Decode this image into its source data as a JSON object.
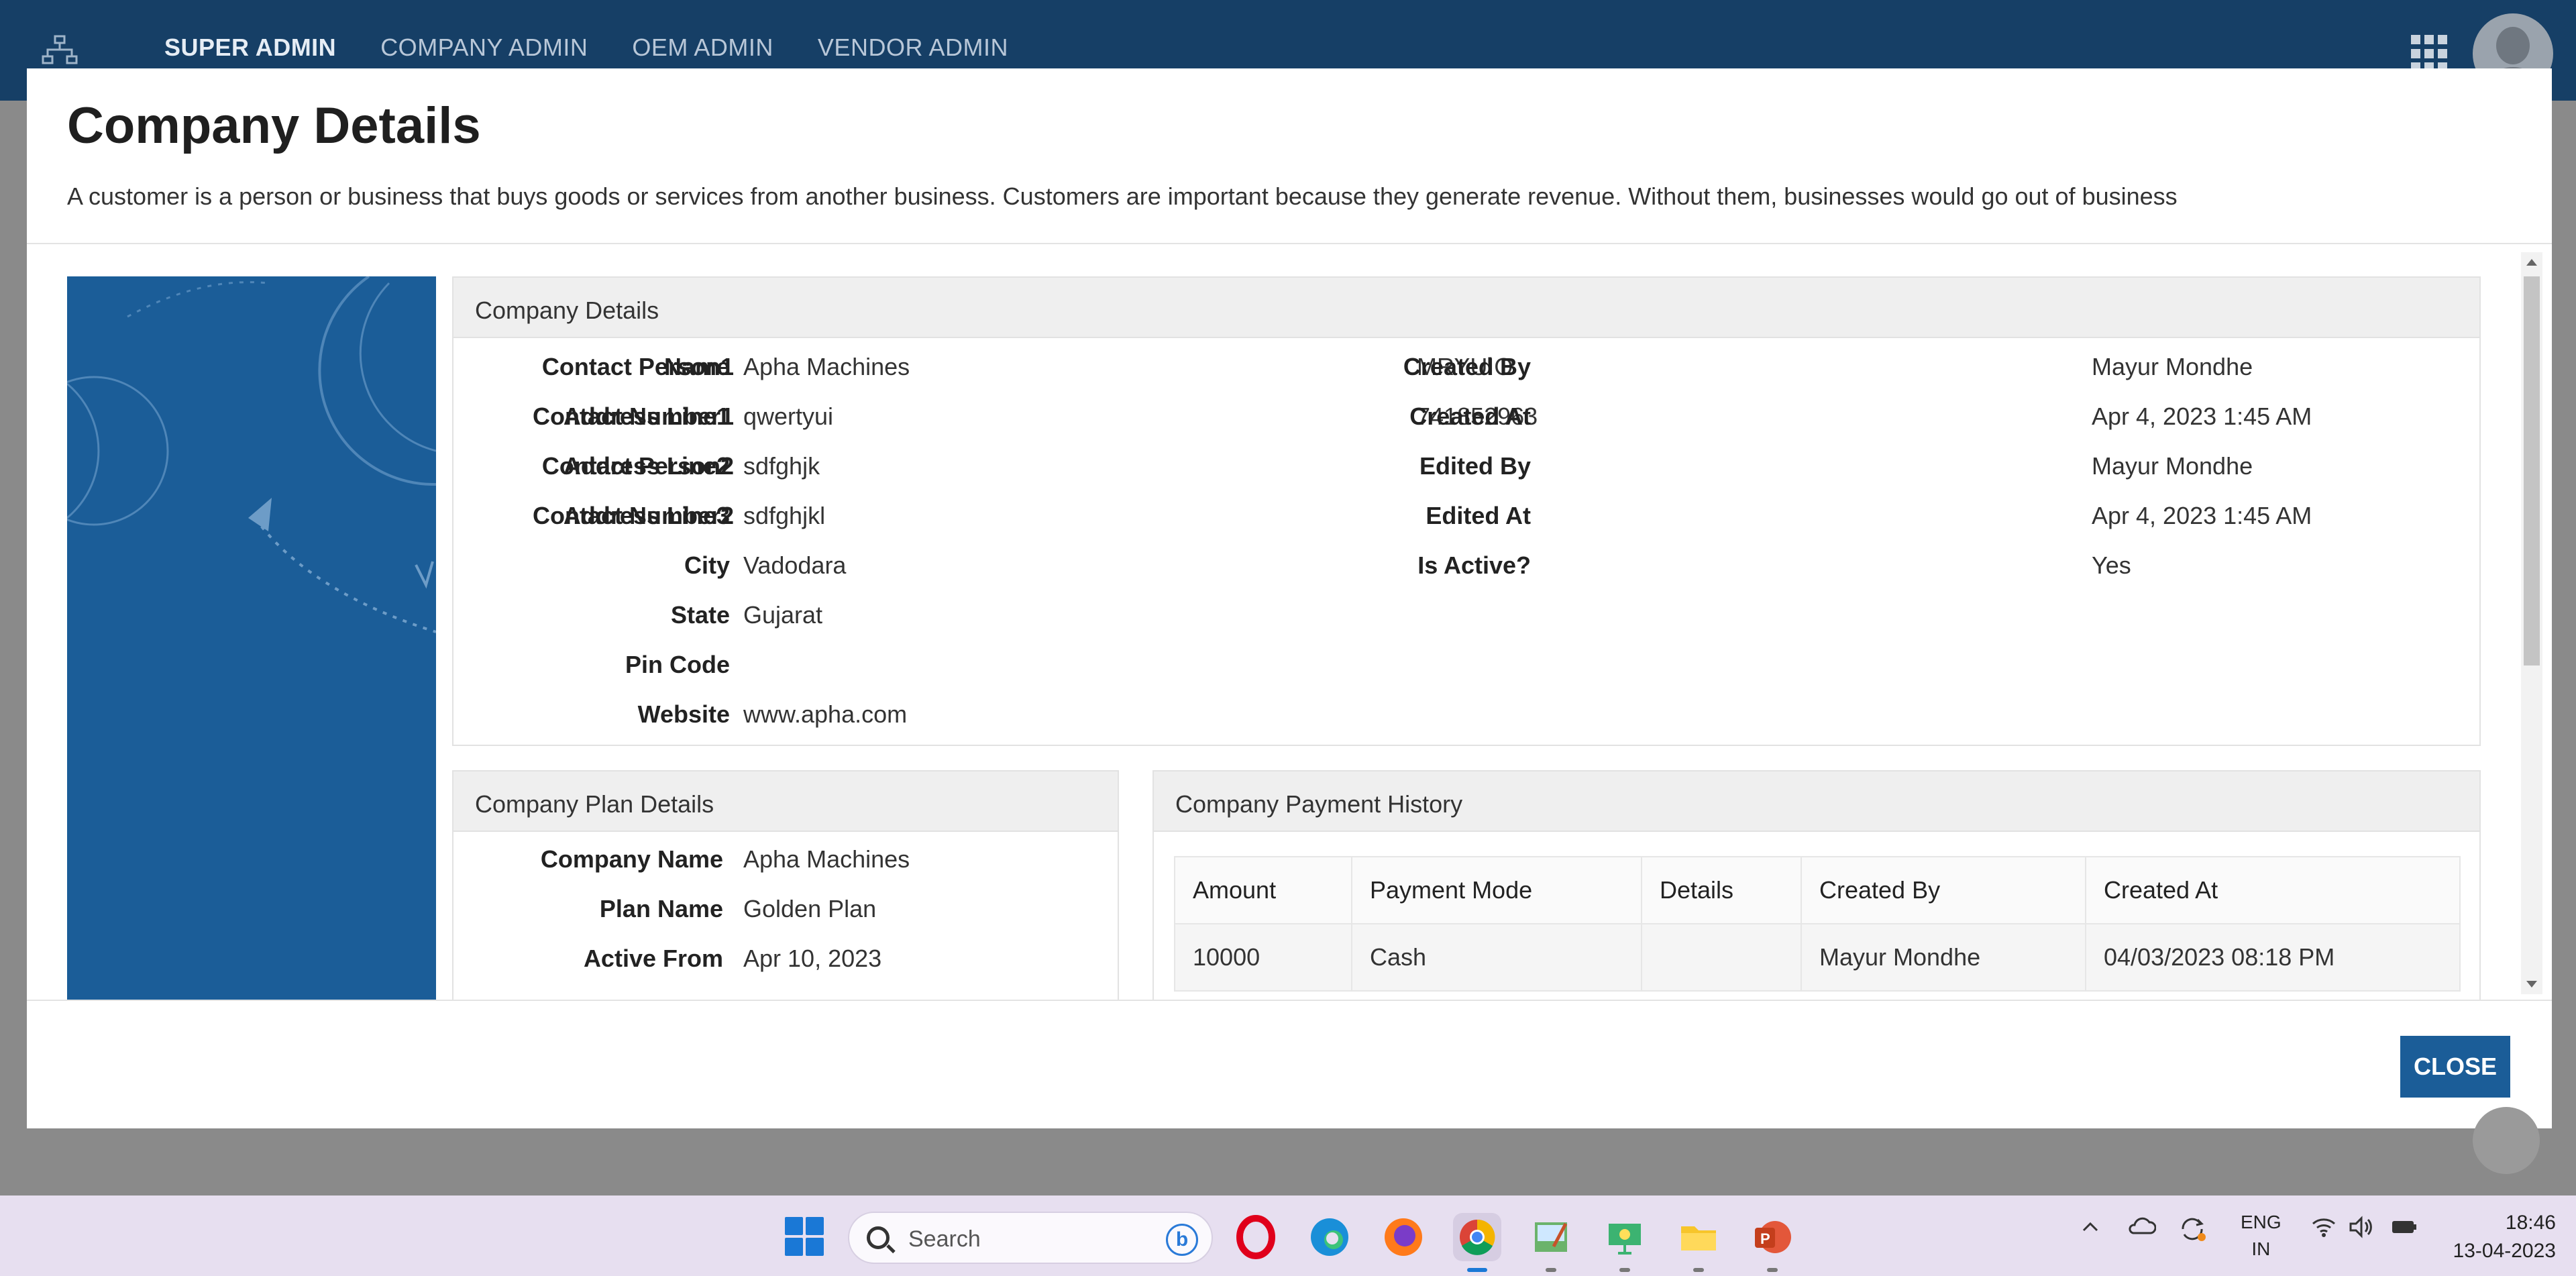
{
  "topbar": {
    "nav": [
      "SUPER ADMIN",
      "COMPANY ADMIN",
      "OEM ADMIN",
      "VENDOR ADMIN"
    ],
    "active_index": 0
  },
  "modal": {
    "title": "Company Details",
    "description": "A customer is a person or business that buys goods or services from another business. Customers are important because they generate revenue. Without them, businesses would go out of business",
    "close_label": "CLOSE"
  },
  "company_details": {
    "heading": "Company Details",
    "col1": [
      {
        "label": "Name",
        "value": "Apha Machines"
      },
      {
        "label": "Address Line1",
        "value": "qwertyui"
      },
      {
        "label": "Address Line2",
        "value": "sdfghjk"
      },
      {
        "label": "Address Line3",
        "value": "sdfghjkl"
      },
      {
        "label": "City",
        "value": "Vadodara"
      },
      {
        "label": "State",
        "value": "Gujarat"
      },
      {
        "label": "Pin Code",
        "value": ""
      },
      {
        "label": "Website",
        "value": "www.apha.com"
      }
    ],
    "col2": [
      {
        "label": "Contact Person1",
        "value": "MRYUIO"
      },
      {
        "label": "Contact Number1",
        "value": "741852963"
      },
      {
        "label": "Contact Person2",
        "value": ""
      },
      {
        "label": "Contact Number2",
        "value": ""
      }
    ],
    "col3": [
      {
        "label": "Created By",
        "value": "Mayur Mondhe"
      },
      {
        "label": "Created At",
        "value": "Apr 4, 2023 1:45 AM"
      },
      {
        "label": "Edited By",
        "value": "Mayur Mondhe"
      },
      {
        "label": "Edited At",
        "value": "Apr 4, 2023 1:45 AM"
      },
      {
        "label": "Is Active?",
        "value": "Yes"
      }
    ]
  },
  "plan_details": {
    "heading": "Company Plan Details",
    "rows": [
      {
        "label": "Company Name",
        "value": "Apha Machines"
      },
      {
        "label": "Plan Name",
        "value": "Golden Plan"
      },
      {
        "label": "Active From",
        "value": "Apr 10, 2023"
      }
    ]
  },
  "payment_history": {
    "heading": "Company Payment History",
    "columns": [
      "Amount",
      "Payment Mode",
      "Details",
      "Created By",
      "Created At"
    ],
    "rows": [
      [
        "10000",
        "Cash",
        "",
        "Mayur Mondhe",
        "04/03/2023 08:18 PM"
      ]
    ]
  },
  "taskbar": {
    "search_placeholder": "Search",
    "lang_line1": "ENG",
    "lang_line2": "IN",
    "time": "18:46",
    "date": "13-04-2023"
  }
}
